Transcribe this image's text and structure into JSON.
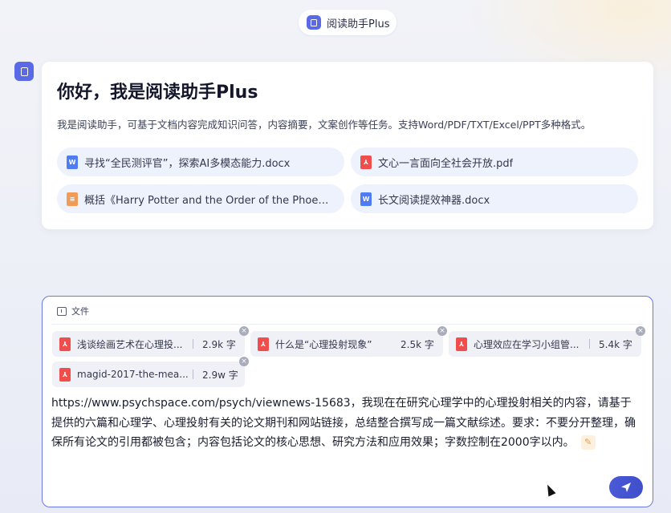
{
  "header": {
    "title": "阅读助手Plus"
  },
  "greeting": {
    "title": "你好，我是阅读助手Plus",
    "description": "我是阅读助手，可基于文档内容完成知识问答，内容摘要，文案创作等任务。支持Word/PDF/TXT/Excel/PPT多种格式。"
  },
  "suggestions": [
    {
      "label": "寻找“全民测评官”，探索AI多模态能力.docx",
      "icon": "word-file-icon"
    },
    {
      "label": "文心一言面向全社会开放.pdf",
      "icon": "pdf-file-icon"
    },
    {
      "label": "概括《Harry Potter and the Order of the Phoenix...",
      "icon": "txt-file-icon"
    },
    {
      "label": "长文阅读提效神器.docx",
      "icon": "word-file-icon"
    }
  ],
  "input": {
    "tab_label": "文件",
    "files": [
      {
        "name": "浅谈绘画艺术在心理投...",
        "size": "2.9k 字"
      },
      {
        "name": "什么是“心理投射现象”",
        "size": "2.5k 字"
      },
      {
        "name": "心理效应在学习小组管...",
        "size": "5.4k 字"
      },
      {
        "name": "magid-2017-the-mea...",
        "size": "2.9w 字"
      }
    ],
    "query": "https://www.psychspace.com/psych/viewnews-15683，我现在在研究心理学中的心理投射相关的内容，请基于提供的六篇和心理学、心理投射有关的论文期刊和网站链接，总结整合撰写成一篇文献综述。要求：不要分开整理，确保所有论文的引用都被包含；内容包括论文的核心思想、研究方法和应用效果；字数控制在2000字以内。"
  },
  "colors": {
    "accent": "#4a5ad8",
    "word": "#4f7cf2",
    "pdf": "#f04d4d",
    "txt": "#f29b57"
  }
}
